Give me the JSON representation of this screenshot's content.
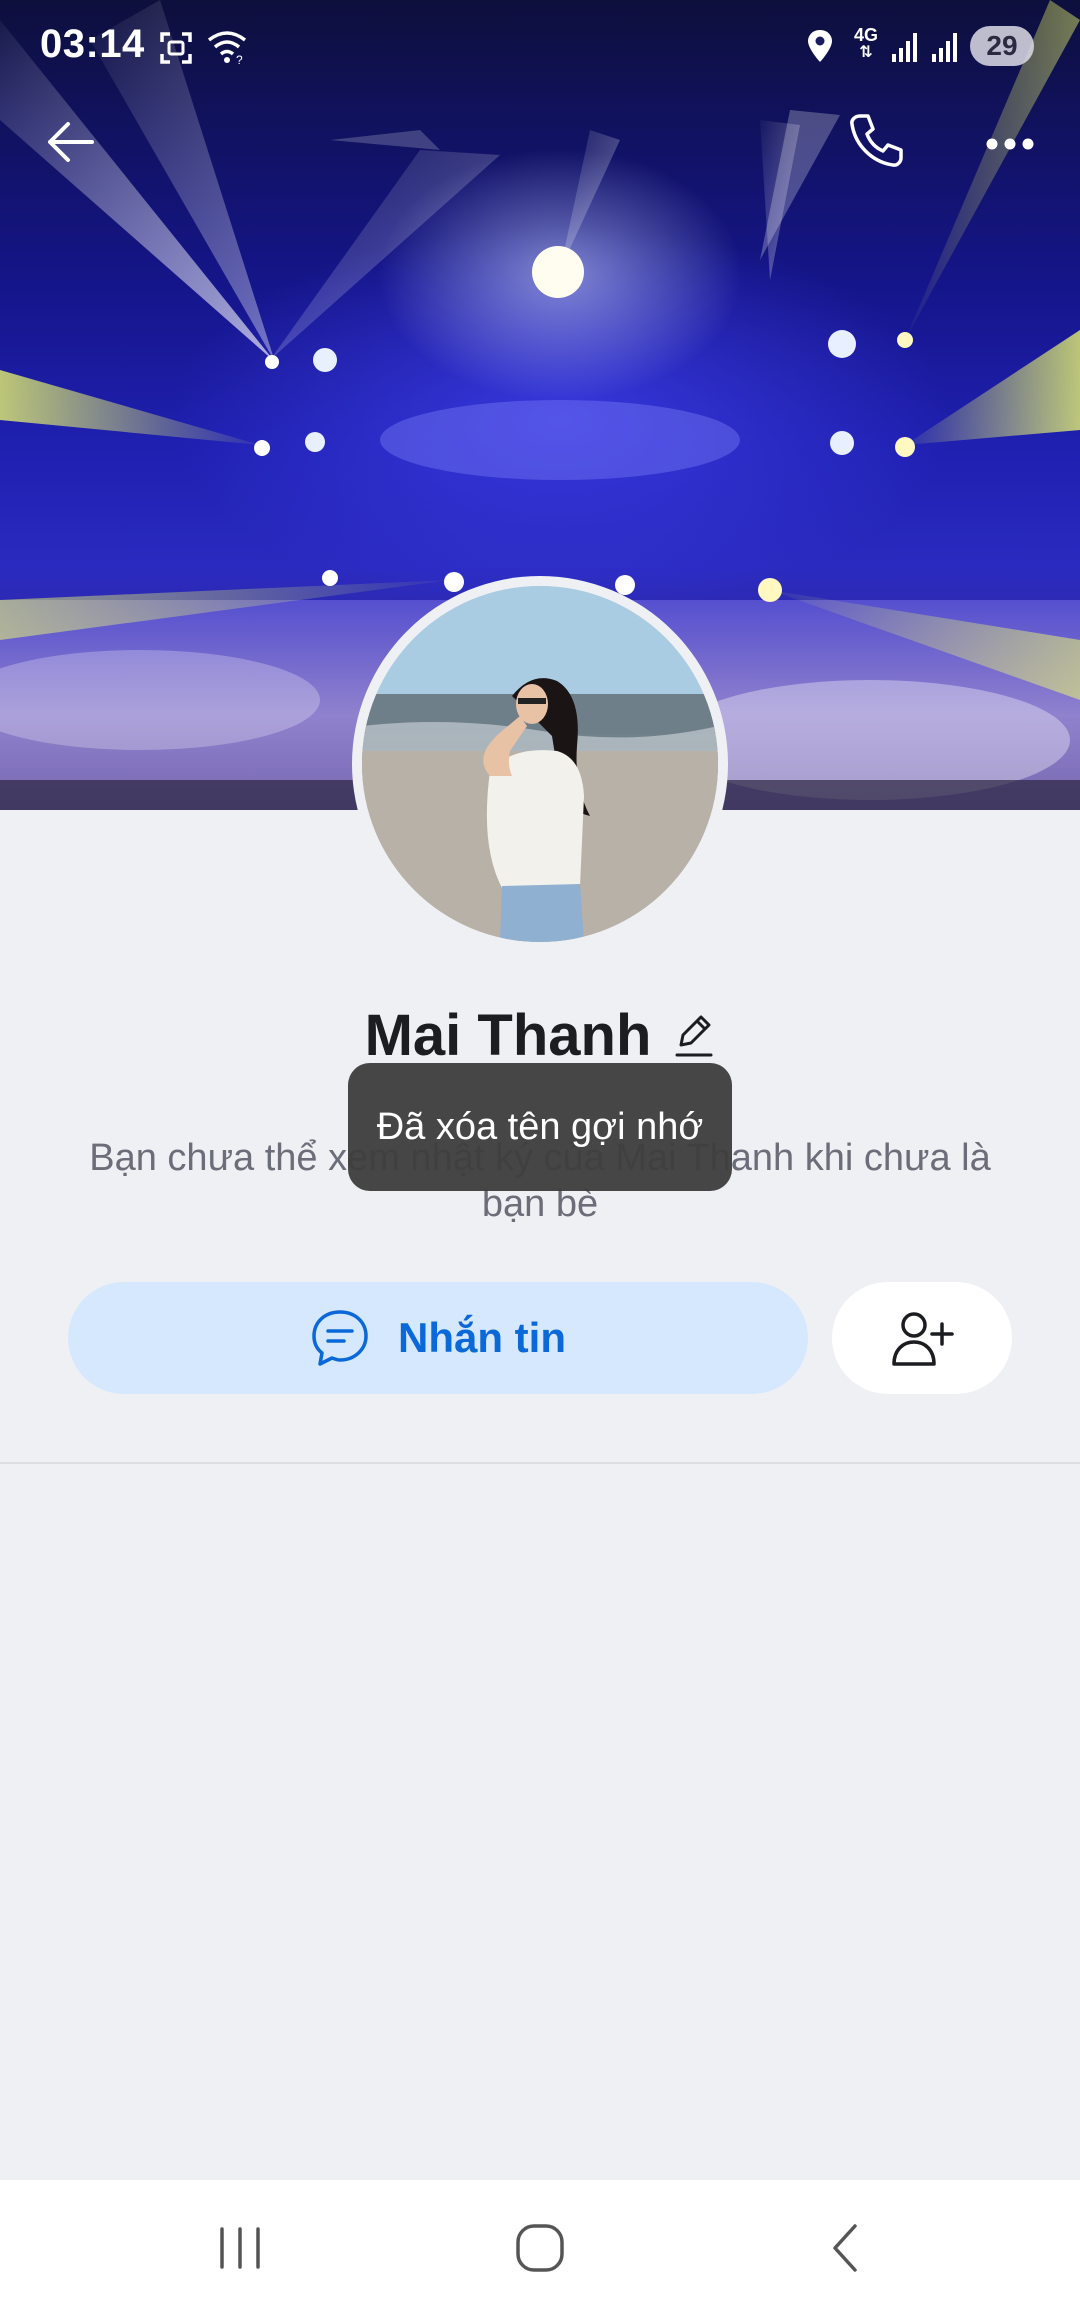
{
  "status_bar": {
    "time": "03:14",
    "network": "4G",
    "battery": "29",
    "icons": [
      "screenshot-icon",
      "wifi-icon",
      "location-icon",
      "data-arrows-icon",
      "signal-icon",
      "signal-icon"
    ]
  },
  "header": {
    "back_icon": "back-arrow-icon",
    "call_icon": "phone-icon",
    "more_icon": "more-icon"
  },
  "profile": {
    "name": "Mai Thanh",
    "description": "Bạn chưa thể xem nhật ký của Mai Thanh khi chưa là bạn bè"
  },
  "toast": {
    "text": "Đã xóa tên gợi nhớ"
  },
  "actions": {
    "message_label": "Nhắn tin",
    "add_friend_icon": "add-friend-icon"
  },
  "system_nav": [
    "recents-icon",
    "home-icon",
    "back-icon"
  ],
  "colors": {
    "accent": "#0a68d8",
    "message_button_bg": "#d6e8fd",
    "page_bg": "#eff0f4"
  }
}
